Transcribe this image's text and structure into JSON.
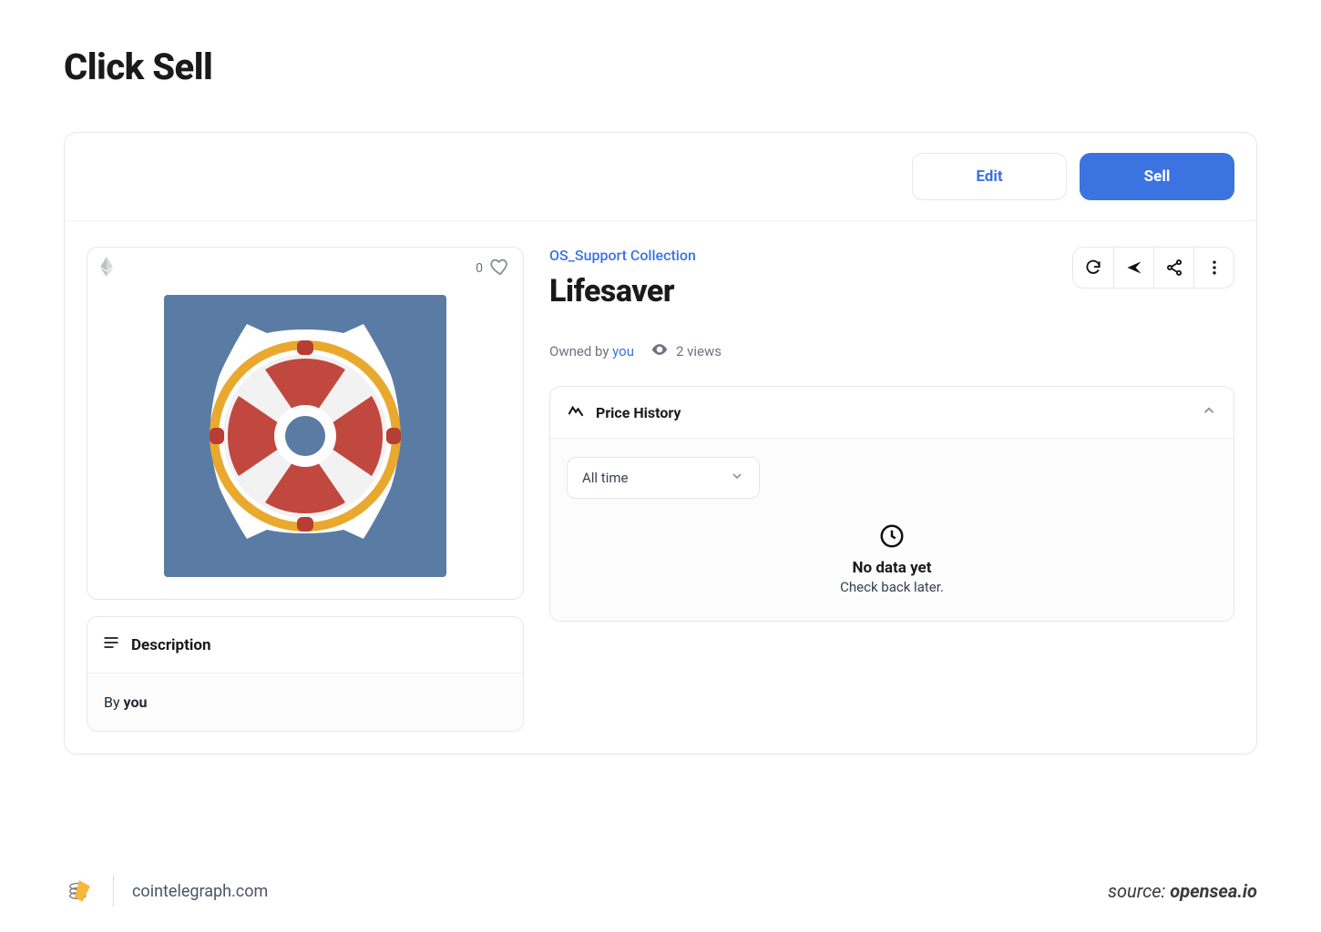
{
  "page_title": "Click Sell",
  "topbar": {
    "edit": "Edit",
    "sell": "Sell"
  },
  "media": {
    "favorites": "0"
  },
  "description": {
    "heading": "Description",
    "by_prefix": "By ",
    "by_who": "you"
  },
  "item": {
    "collection": "OS_Support Collection",
    "title": "Lifesaver",
    "owned_prefix": "Owned by ",
    "owned_by": "you",
    "views": "2 views"
  },
  "price_history": {
    "heading": "Price History",
    "range": "All time",
    "empty_title": "No data yet",
    "empty_sub": "Check back later."
  },
  "footer": {
    "site": "cointelegraph.com",
    "source_label": "source: ",
    "source_value": "opensea.io"
  }
}
